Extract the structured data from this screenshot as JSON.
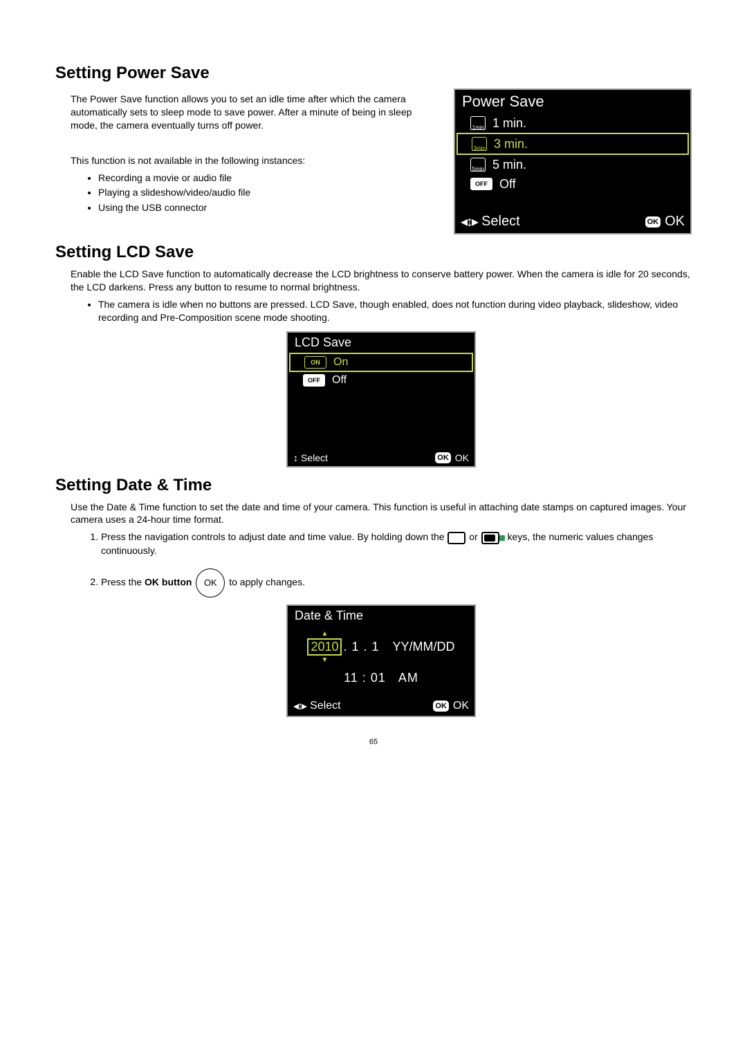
{
  "page_number": "65",
  "power_save": {
    "heading": "Setting Power Save",
    "para1": "The Power Save function allows you to set an idle time after which the camera automatically sets to sleep mode to save power. After a minute of being in sleep mode, the camera eventually turns off power.",
    "para2": "This function is not available in the following instances:",
    "bullets": [
      "Recording a movie or audio file",
      "Playing a slideshow/video/audio file",
      "Using the USB connector"
    ],
    "lcd": {
      "title": "Power Save",
      "options": [
        {
          "icon": "1min",
          "label": "1 min."
        },
        {
          "icon": "3min",
          "label": "3 min."
        },
        {
          "icon": "5min",
          "label": "5 min."
        },
        {
          "icon": "OFF",
          "label": "Off"
        }
      ],
      "selected_index": 1,
      "footer_select": "Select",
      "footer_ok": "OK"
    }
  },
  "lcd_save": {
    "heading": "Setting LCD Save",
    "para1": "Enable the LCD Save function to automatically decrease the LCD brightness to conserve battery power. When the camera is idle for 20 seconds, the LCD darkens. Press any button to resume to normal brightness.",
    "bullets": [
      "The camera is idle when no buttons are pressed. LCD Save, though enabled, does not function during video playback, slideshow, video recording and Pre-Composition scene mode shooting."
    ],
    "lcd": {
      "title": "LCD Save",
      "options": [
        {
          "icon": "ON",
          "label": "On"
        },
        {
          "icon": "OFF",
          "label": "Off"
        }
      ],
      "selected_index": 0,
      "footer_select": "Select",
      "footer_ok": "OK"
    }
  },
  "date_time": {
    "heading": "Setting Date & Time",
    "para1": "Use the Date & Time function to set the date and time of your camera. This function is useful in attaching date stamps on captured images. Your camera uses a 24-hour time format.",
    "step1a": "Press the navigation controls to adjust date and time value. By holding down the ",
    "step1b": " or ",
    "step1c": " keys, the numeric values changes continuously.",
    "step2a": "Press the ",
    "step2b": "OK button",
    "step2c": " to apply changes.",
    "ok_btn": "OK",
    "lcd": {
      "title": "Date & Time",
      "year": "2010",
      "month": "1",
      "day": "1",
      "fmt": "YY/MM/DD",
      "time": "11 : 01",
      "ampm": "AM",
      "footer_select": "Select",
      "footer_ok": "OK"
    }
  }
}
